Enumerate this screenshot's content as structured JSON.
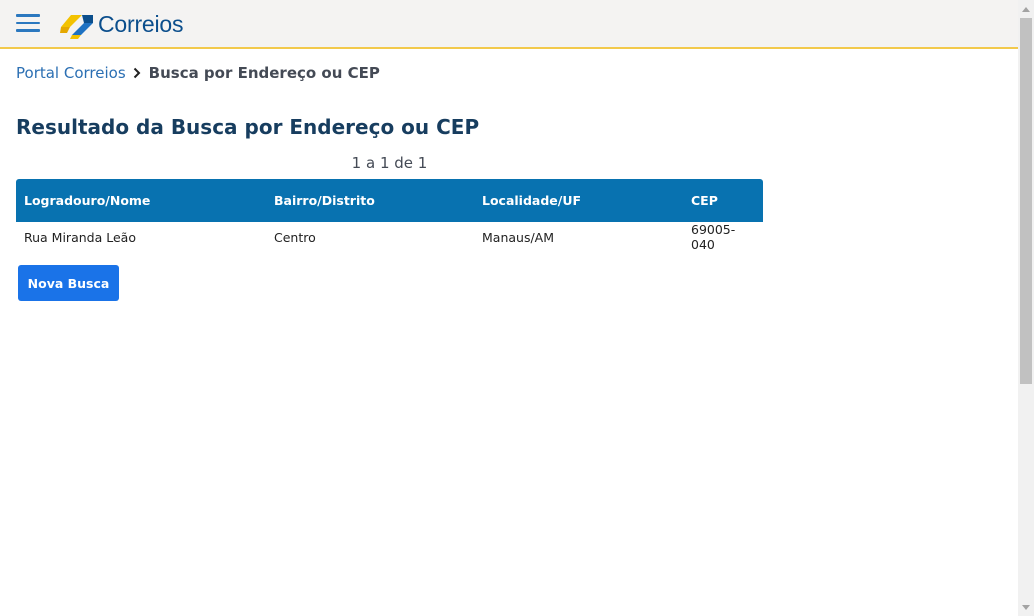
{
  "header": {
    "logo_text": "Correios",
    "accent_color": "#f2c94c",
    "logo_colors": [
      "#f3c200",
      "#0b4e8c"
    ]
  },
  "breadcrumb": {
    "home": "Portal Correios",
    "separator_icon": "chevron-right-icon",
    "current": "Busca por Endereço ou CEP"
  },
  "main": {
    "title": "Resultado da Busca por Endereço ou CEP",
    "pagination": "1 a 1 de 1",
    "table": {
      "headers": [
        "Logradouro/Nome",
        "Bairro/Distrito",
        "Localidade/UF",
        "CEP"
      ],
      "rows": [
        [
          "Rua Miranda Leão",
          "Centro",
          "Manaus/AM",
          "69005-040"
        ]
      ]
    },
    "new_search_label": "Nova Busca"
  },
  "colors": {
    "table_header_bg": "#0872b0",
    "button_bg": "#1a73e8",
    "title": "#173d5f",
    "link": "#2b6fb3"
  }
}
